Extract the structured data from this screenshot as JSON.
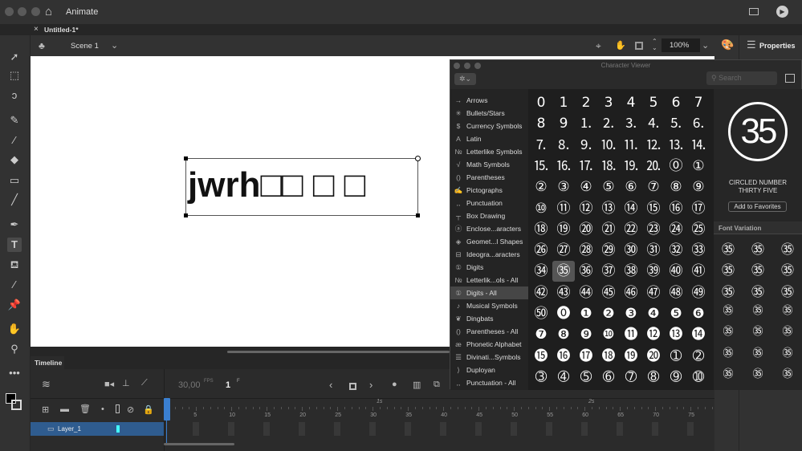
{
  "app": {
    "title": "Animate",
    "tab": "Untitled-1*",
    "close": "×"
  },
  "scene": {
    "label": "Scene 1",
    "zoom": "100%"
  },
  "stage": {
    "text": "jwrh□□ □ □"
  },
  "right_panel": {
    "properties": "Properties"
  },
  "char_viewer": {
    "title": "Character Viewer",
    "search_placeholder": "Search",
    "categories": [
      {
        "glyph": "→",
        "label": "Arrows"
      },
      {
        "glyph": "✳",
        "label": "Bullets/Stars"
      },
      {
        "glyph": "$",
        "label": "Currency Symbols"
      },
      {
        "glyph": "A",
        "label": "Latin"
      },
      {
        "glyph": "№",
        "label": "Letterlike Symbols"
      },
      {
        "glyph": "√",
        "label": "Math Symbols"
      },
      {
        "glyph": "()",
        "label": "Parentheses"
      },
      {
        "glyph": "✍",
        "label": "Pictographs"
      },
      {
        "glyph": ",,",
        "label": "Punctuation"
      },
      {
        "glyph": "┬",
        "label": "Box Drawing"
      },
      {
        "glyph": "ⓐ",
        "label": "Enclose...aracters"
      },
      {
        "glyph": "◈",
        "label": "Geomet...l Shapes"
      },
      {
        "glyph": "⊟",
        "label": "Ideogra...aracters"
      },
      {
        "glyph": "①",
        "label": "Digits"
      },
      {
        "glyph": "№",
        "label": "Letterlik...ols - All"
      },
      {
        "glyph": "①",
        "label": "Digits - All",
        "selected": true
      },
      {
        "glyph": "♪",
        "label": "Musical Symbols"
      },
      {
        "glyph": "❦",
        "label": "Dingbats"
      },
      {
        "glyph": "()",
        "label": "Parentheses - All"
      },
      {
        "glyph": "æ",
        "label": "Phonetic Alphabet"
      },
      {
        "glyph": "☰",
        "label": "Divinati...Symbols"
      },
      {
        "glyph": "⟩",
        "label": "Duployan"
      },
      {
        "glyph": ",,",
        "label": "Punctuation - All"
      }
    ],
    "characters": [
      "0",
      "1",
      "2",
      "3",
      "4",
      "5",
      "6",
      "7",
      "8",
      "9",
      "⒈",
      "⒉",
      "⒊",
      "⒋",
      "⒌",
      "⒍",
      "⒎",
      "⒏",
      "⒐",
      "⒑",
      "⒒",
      "⒓",
      "⒔",
      "⒕",
      "⒖",
      "⒗",
      "⒘",
      "⒙",
      "⒚",
      "⒛",
      "⓪",
      "①",
      "②",
      "③",
      "④",
      "⑤",
      "⑥",
      "⑦",
      "⑧",
      "⑨",
      "⑩",
      "⑪",
      "⑫",
      "⑬",
      "⑭",
      "⑮",
      "⑯",
      "⑰",
      "⑱",
      "⑲",
      "⑳",
      "㉑",
      "㉒",
      "㉓",
      "㉔",
      "㉕",
      "㉖",
      "㉗",
      "㉘",
      "㉙",
      "㉚",
      "㉛",
      "㉜",
      "㉝",
      "㉞",
      "㉟",
      "㊱",
      "㊲",
      "㊳",
      "㊴",
      "㊵",
      "㊶",
      "㊷",
      "㊸",
      "㊹",
      "㊺",
      "㊻",
      "㊼",
      "㊽",
      "㊾",
      "㊿",
      "⓿",
      "❶",
      "❷",
      "❸",
      "❹",
      "❺",
      "❻",
      "❼",
      "❽",
      "❾",
      "❿",
      "⓫",
      "⓬",
      "⓭",
      "⓮",
      "⓯",
      "⓰",
      "⓱",
      "⓲",
      "⓳",
      "⓴",
      "➀",
      "➁",
      "➂",
      "➃",
      "➄",
      "➅",
      "➆",
      "➇",
      "➈",
      "➉"
    ],
    "selected_char": "㉟",
    "selected_name": "CIRCLED NUMBER THIRTY FIVE",
    "add_favorites": "Add to Favorites",
    "font_variation": "Font Variation",
    "variation_count": 21
  },
  "timeline": {
    "title": "Timeline",
    "fps": "30,00",
    "fps_unit": "FPS",
    "frame": "1",
    "frame_unit": "F",
    "layer": "Layer_1",
    "ruler": [
      "5",
      "10",
      "15",
      "20",
      "25",
      "30",
      "35",
      "40",
      "45",
      "50",
      "55",
      "60",
      "65",
      "70",
      "75"
    ],
    "seconds": [
      "1s",
      "2s"
    ]
  }
}
